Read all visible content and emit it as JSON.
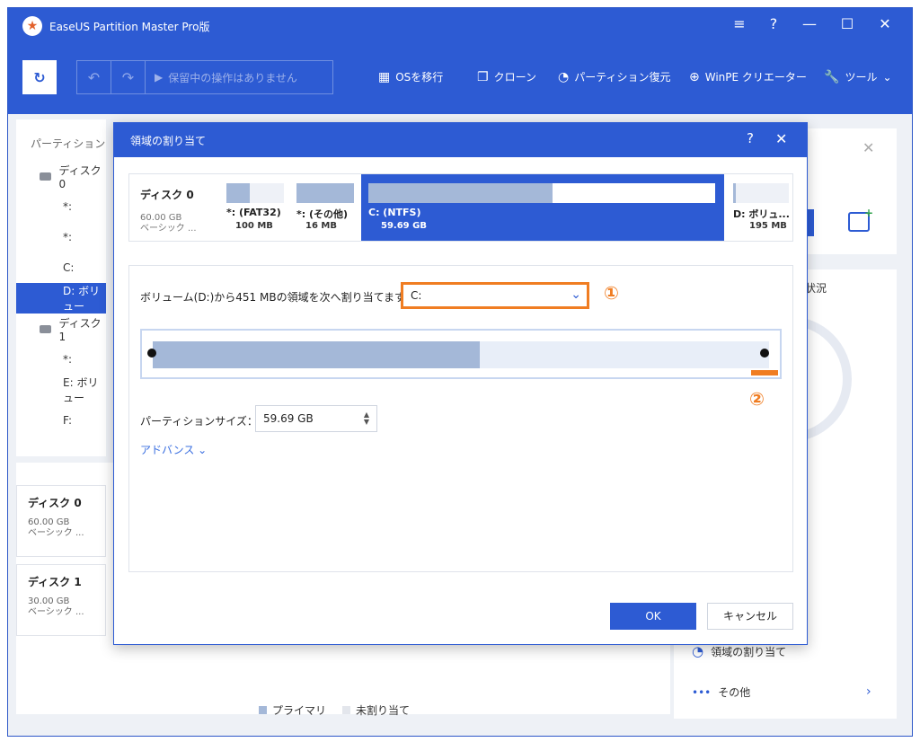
{
  "window": {
    "title": "EaseUS Partition Master Pro版",
    "controls": {
      "menu": "≡",
      "help": "?",
      "minimize": "—",
      "maximize": "☐",
      "close": "✕"
    }
  },
  "toolbar": {
    "pending_label": "保留中の操作はありません",
    "items": [
      {
        "label": "OSを移行",
        "icon": "windows-icon"
      },
      {
        "label": "クローン",
        "icon": "clone-icon"
      },
      {
        "label": "パーティション復元",
        "icon": "pie-icon"
      },
      {
        "label": "WinPE クリエーター",
        "icon": "plus-circle-icon"
      },
      {
        "label": "ツール",
        "icon": "wrench-icon"
      }
    ]
  },
  "left_pane": {
    "header": "パーティション",
    "rows": [
      {
        "label": "ディスク0",
        "type": "disk"
      },
      {
        "label": "*:",
        "type": "part"
      },
      {
        "label": "*:",
        "type": "part"
      },
      {
        "label": "C:",
        "type": "part"
      },
      {
        "label": "D: ボリュー",
        "type": "part",
        "selected": true
      },
      {
        "label": "ディスク1",
        "type": "disk"
      },
      {
        "label": "*:",
        "type": "part"
      },
      {
        "label": "E: ボリュー",
        "type": "part"
      },
      {
        "label": "F:",
        "type": "part"
      }
    ]
  },
  "disk_cards": [
    {
      "name": "ディスク 0",
      "size": "60.00 GB",
      "type": "ベーシック ..."
    },
    {
      "name": "ディスク 1",
      "size": "30.00 GB",
      "type": "ベーシック ..."
    }
  ],
  "legend": {
    "primary": "プライマリ",
    "unallocated": "未割り当て"
  },
  "right_pane": {
    "status_title": "状況",
    "actions": [
      {
        "label": "領域の割り当て",
        "icon": "pie-icon"
      },
      {
        "label": "その他",
        "icon": "more-icon"
      }
    ]
  },
  "dialog": {
    "title": "領域の割り当て",
    "disk": {
      "name": "ディスク 0",
      "size": "60.00 GB",
      "type": "ベーシック ..."
    },
    "partitions": [
      {
        "label": "*: (FAT32)",
        "size": "100 MB",
        "used": 0.4
      },
      {
        "label": "*: (その他)",
        "size": "16 MB",
        "used": 1.0
      },
      {
        "label": "C: (NTFS)",
        "size": "59.69 GB",
        "used": 0.53,
        "selected": true
      },
      {
        "label": "D: ボリュ...",
        "size": "195 MB",
        "used": 0.05
      }
    ],
    "allocate_label": "ボリューム(D:)から451 MBの領域を次へ割り当てます：",
    "target_value": "C:",
    "marker_1": "①",
    "marker_2": "②",
    "slider": {
      "used_fraction": 0.53
    },
    "size_label": "パーティションサイズ：",
    "size_value": "59.69 GB",
    "advanced_label": "アドバンス ⌄",
    "ok_label": "OK",
    "cancel_label": "キャンセル"
  },
  "colors": {
    "accent": "#2d5bd3",
    "highlight": "#f07d22",
    "used_fill": "#a4b8d8"
  }
}
